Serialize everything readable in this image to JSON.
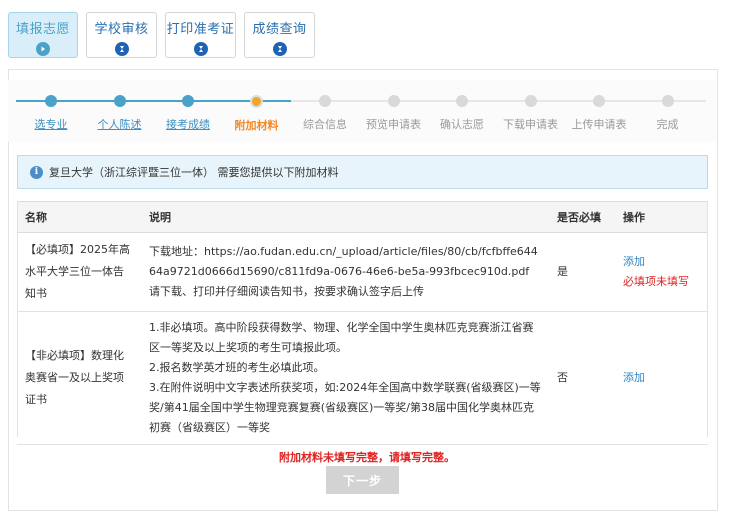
{
  "tabs": [
    {
      "label": "填报志愿",
      "active": true
    },
    {
      "label": "学校审核",
      "active": false
    },
    {
      "label": "打印准考证",
      "active": false
    },
    {
      "label": "成绩查询",
      "active": false
    }
  ],
  "steps": [
    {
      "label": "选专业",
      "state": "done"
    },
    {
      "label": "个人陈述",
      "state": "done"
    },
    {
      "label": "接考成绩",
      "state": "done"
    },
    {
      "label": "附加材料",
      "state": "current"
    },
    {
      "label": "综合信息",
      "state": "todo"
    },
    {
      "label": "预览申请表",
      "state": "todo"
    },
    {
      "label": "确认志愿",
      "state": "todo"
    },
    {
      "label": "下载申请表",
      "state": "todo"
    },
    {
      "label": "上传申请表",
      "state": "todo"
    },
    {
      "label": "完成",
      "state": "todo"
    }
  ],
  "info": {
    "text": "复旦大学（浙江综评暨三位一体） 需要您提供以下附加材料"
  },
  "table": {
    "headers": {
      "name": "名称",
      "desc": "说明",
      "required": "是否必填",
      "action": "操作"
    },
    "rows": [
      {
        "name": "【必填项】2025年高水平大学三位一体告知书",
        "desc_lines": [
          "下载地址：https://ao.fudan.edu.cn/_upload/article/files/80/cb/fcfbffe64464a9721d0666d15690/c811fd9a-0676-46e6-be5a-993fbcec910d.pdf",
          "请下载、打印并仔细阅读告知书，按要求确认签字后上传"
        ],
        "required": "是",
        "action": "添加",
        "warning": "必填项未填写"
      },
      {
        "name": "【非必填项】数理化奥赛省一及以上奖项证书",
        "desc_lines": [
          "1.非必填项。高中阶段获得数学、物理、化学全国中学生奥林匹克竞赛浙江省赛区一等奖及以上奖项的考生可填报此项。",
          "2.报名数学英才班的考生必填此项。",
          "3.在附件说明中文字表述所获奖项，如:2024年全国高中数学联赛(省级赛区)一等奖/第41届全国中学生物理竞赛复赛(省级赛区)一等奖/第38届中国化学奥林匹克初赛（省级赛区）一等奖"
        ],
        "required": "否",
        "action": "添加",
        "warning": ""
      }
    ]
  },
  "footer": {
    "warning": "附加材料未填写完整，请填写完整。",
    "next_label": "下一步"
  },
  "colors": {
    "accent": "#4aa2c9",
    "current": "#f2a623",
    "warn": "#e02222",
    "link": "#2f86c4"
  }
}
